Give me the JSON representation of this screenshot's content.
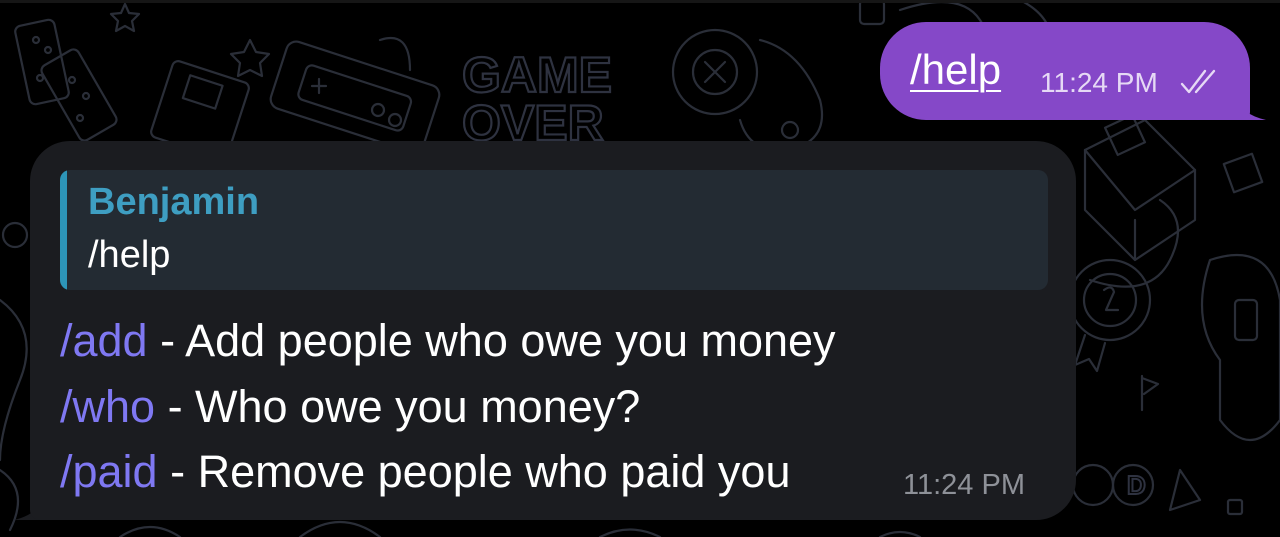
{
  "wallpaper": {
    "description_icons": [
      "dominoes-icon",
      "star-icon",
      "game-controller-icon",
      "floppy-disk-icon",
      "joystick-icon",
      "trophy-badge-icon",
      "flag-icon",
      "gamepad-icon"
    ],
    "game_over_line1": "GAME",
    "game_over_line2": "OVER",
    "button_label": "D",
    "line_color": "#2b2f3a"
  },
  "outgoing_message": {
    "text": "/help",
    "time": "11:24 PM",
    "status_icon": "double-check-icon",
    "bubble_color": "#8548c8"
  },
  "incoming_message": {
    "reply": {
      "author": "Benjamin",
      "text": "/help"
    },
    "lines": [
      {
        "command": "/add",
        "description": " - Add people who owe you money"
      },
      {
        "command": "/who",
        "description": " - Who owe you money?"
      },
      {
        "command": "/paid",
        "description": " - Remove people who paid you"
      }
    ],
    "time": "11:24 PM",
    "bubble_color": "#1b1c20",
    "command_color": "#7f78f2",
    "reply_accent_color": "#2d95b8"
  }
}
